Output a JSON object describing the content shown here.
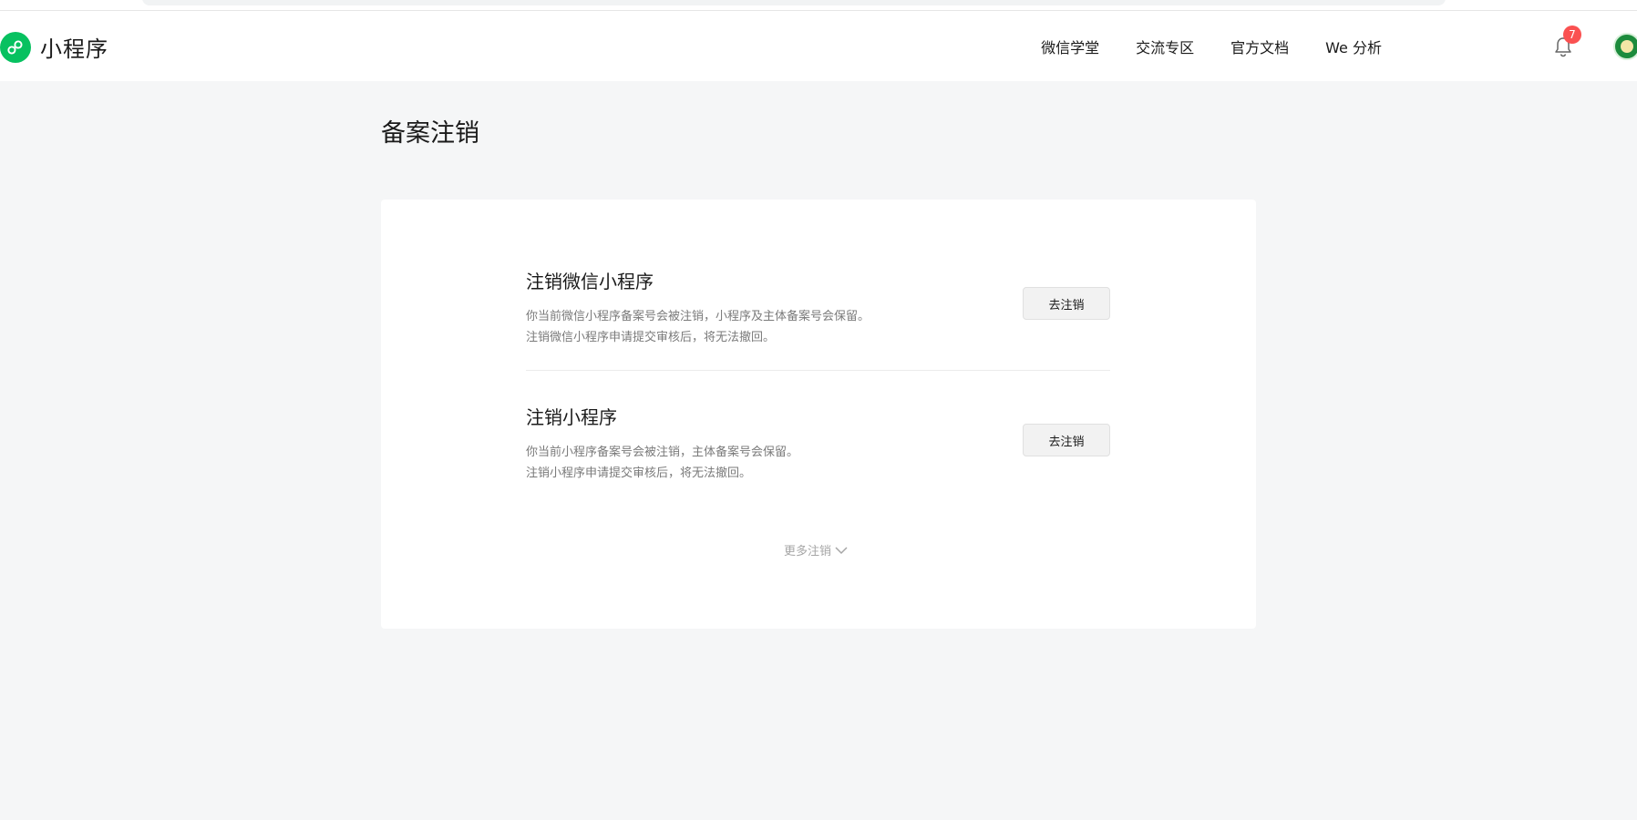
{
  "brand": {
    "name": "小程序",
    "logo_icon": "mini-program-logo-icon",
    "accent": "#07c160"
  },
  "nav": {
    "items": [
      {
        "label": "微信学堂"
      },
      {
        "label": "交流专区"
      },
      {
        "label": "官方文档"
      },
      {
        "label": "We 分析"
      }
    ],
    "notifications": {
      "count": "7",
      "icon": "bell-icon"
    }
  },
  "page": {
    "title": "备案注销"
  },
  "sections": [
    {
      "title": "注销微信小程序",
      "lines": [
        "你当前微信小程序备案号会被注销，小程序及主体备案号会保留。",
        "注销微信小程序申请提交审核后，将无法撤回。"
      ],
      "button": "去注销"
    },
    {
      "title": "注销小程序",
      "lines": [
        "你当前小程序备案号会被注销，主体备案号会保留。",
        "注销小程序申请提交审核后，将无法撤回。"
      ],
      "button": "去注销"
    }
  ],
  "more": {
    "label": "更多注销",
    "icon": "chevron-down-icon"
  },
  "colors": {
    "badge": "#fa5151",
    "background": "#f5f6f7"
  }
}
